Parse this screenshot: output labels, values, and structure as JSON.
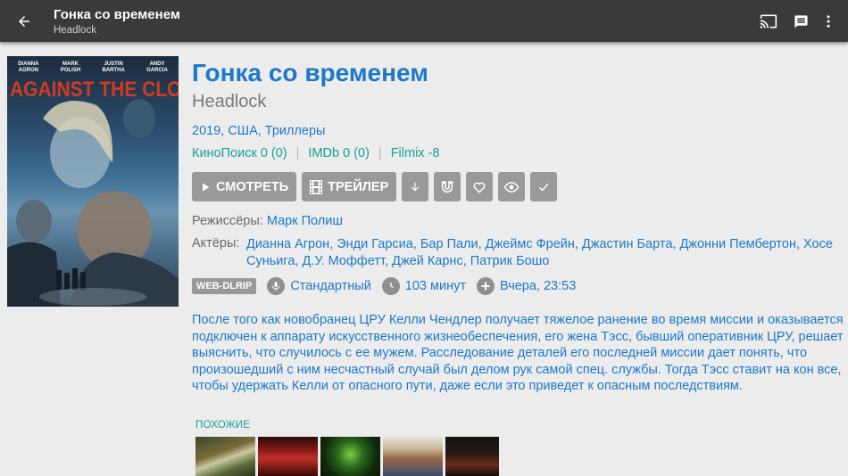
{
  "appbar": {
    "title": "Гонка со временем",
    "subtitle": "Headlock",
    "icons": [
      "back-arrow-icon",
      "cast-icon",
      "comment-icon",
      "more-vert-icon"
    ]
  },
  "poster": {
    "names": [
      "DIANNA\nAGRON",
      "MARK\nPOLISH",
      "JUSTIN\nBARTHA",
      "ANDY\nGARCIA"
    ],
    "title": "AGAINST THE CLOCK"
  },
  "movie": {
    "title": "Гонка со временем",
    "original_title": "Headlock",
    "meta": "2019, США, Триллеры",
    "ratings": [
      "КиноПоиск 0 (0)",
      "IMDb 0 (0)",
      "Filmix -8"
    ],
    "sep": "|"
  },
  "buttons": {
    "watch": "СМОТРЕТЬ",
    "trailer": "ТРЕЙЛЕР"
  },
  "credits": {
    "directors_label": "Режиссёры:",
    "directors": "Марк Полиш",
    "actors_label": "Актёры:",
    "actors": "Дианна Агрон, Энди Гарсиа, Бар Пали, Джеймс Фрейн, Джастин Барта, Джонни Пембертон, Хосе Суньига, Д.У. Моффетт, Джей Карнс, Патрик Бошо"
  },
  "tags": {
    "quality": "WEB-DLRIP",
    "translation": "Стандартный",
    "duration": "103 минут",
    "added": "Вчера, 23:53"
  },
  "description": "После того как новобранец ЦРУ Келли Чендлер получает тяжелое ранение во время миссии и оказывается подключен к аппарату искусственного жизнеобеспечения, его жена Тэсс, бывший оперативник ЦРУ, решает выяснить, что случилось с ее мужем. Расследование деталей его последней миссии дает понять, что произошедший с ним несчастный случай был делом рук самой спец. службы. Тогда Тэсс ставит на кон все, чтобы удержать Келли от опасного пути, даже если это приведет к опасным последствиям.",
  "similar": {
    "label": "ПОХОЖИЕ"
  },
  "colors": {
    "appbar": "#3a3a3a",
    "background": "#ececec",
    "link_blue": "#1e78c8",
    "teal": "#13a196",
    "button_gray": "#999999",
    "poster_title_red": "#d33a22"
  }
}
